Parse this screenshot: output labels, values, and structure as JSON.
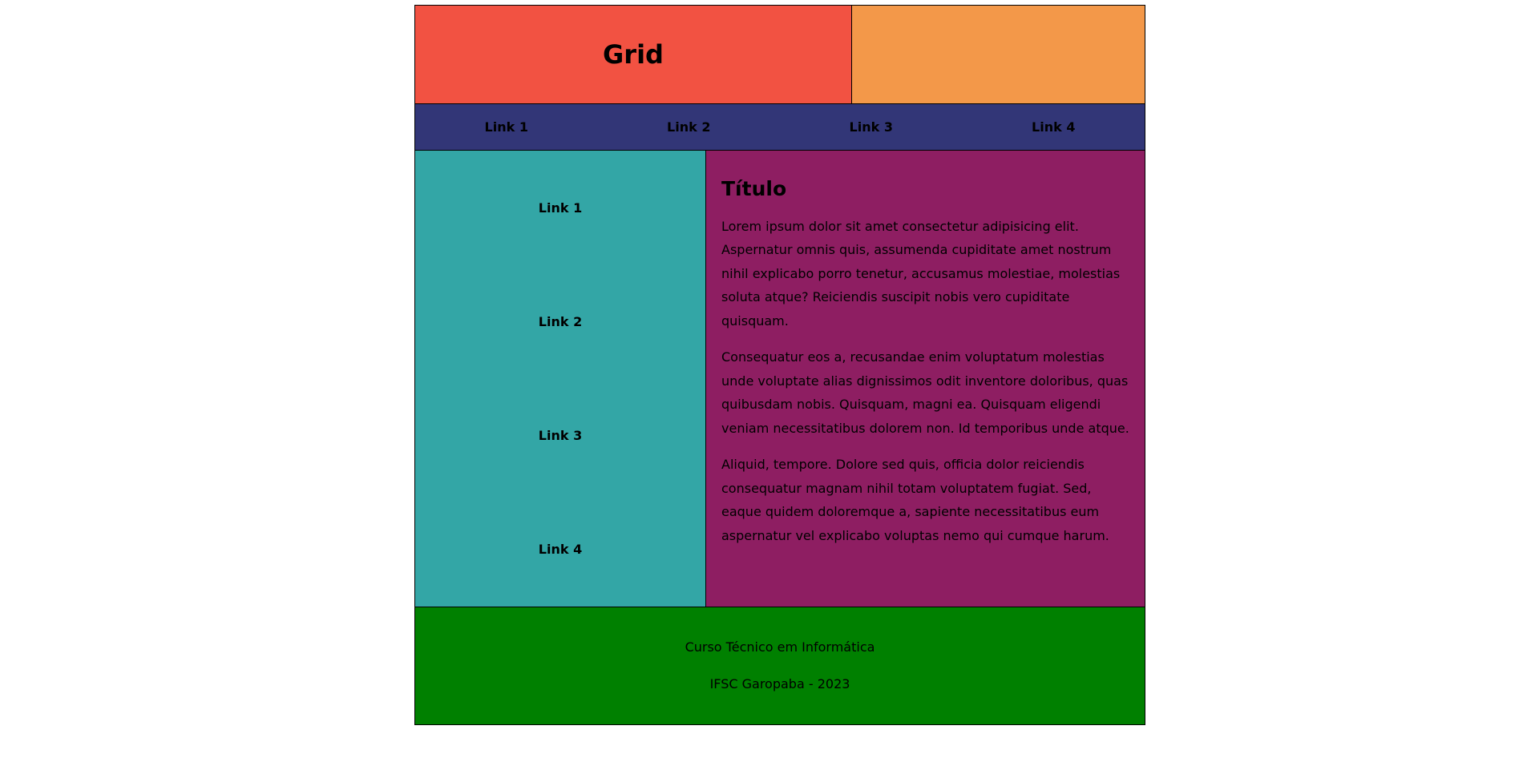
{
  "header": {
    "title": "Grid"
  },
  "topnav": {
    "links": [
      "Link 1",
      "Link 2",
      "Link 3",
      "Link 4"
    ]
  },
  "sidenav": {
    "links": [
      "Link 1",
      "Link 2",
      "Link 3",
      "Link 4"
    ]
  },
  "content": {
    "title": "Título",
    "paragraphs": [
      "Lorem ipsum dolor sit amet consectetur adipisicing elit. Aspernatur omnis quis, assumenda cupiditate amet nostrum nihil explicabo porro tenetur, accusamus molestiae, molestias soluta atque? Reiciendis suscipit nobis vero cupiditate quisquam.",
      "Consequatur eos a, recusandae enim voluptatum molestias unde voluptate alias dignissimos odit inventore doloribus, quas quibusdam nobis. Quisquam, magni ea. Quisquam eligendi veniam necessitatibus dolorem non. Id temporibus unde atque.",
      "Aliquid, tempore. Dolore sed quis, officia dolor reiciendis consequatur magnam nihil totam voluptatem fugiat. Sed, eaque quidem doloremque a, sapiente necessitatibus eum aspernatur vel explicabo voluptas nemo qui cumque harum."
    ]
  },
  "footer": {
    "line1": "Curso Técnico em Informática",
    "line2": "IFSC Garopaba - 2023"
  },
  "colors": {
    "header": "#f25242",
    "logo_box": "#f39849",
    "topnav": "#323677",
    "sidenav": "#33a6a6",
    "content": "#8e1e62",
    "footer": "#008000"
  }
}
